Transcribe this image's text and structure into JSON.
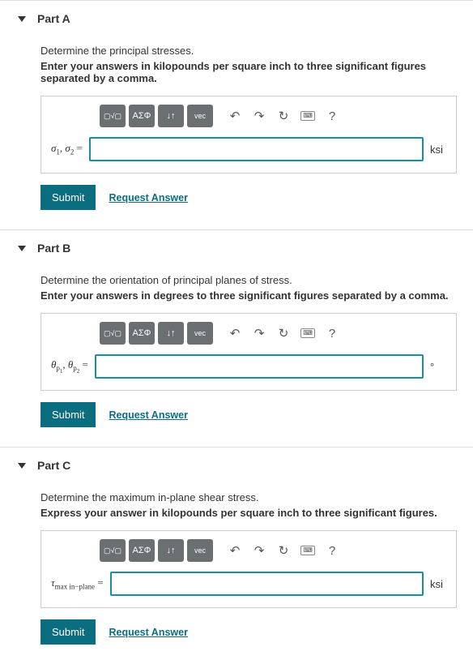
{
  "parts": [
    {
      "title": "Part A",
      "prompt": "Determine the principal stresses.",
      "instruction": "Enter your answers in kilopounds per square inch to three significant figures separated by a comma.",
      "var_html": "<span class='it'>σ</span><sub>1</sub>, <span class='it'>σ</span><sub>2</sub> =",
      "unit": "ksi",
      "value": "",
      "submit": "Submit",
      "request": "Request Answer"
    },
    {
      "title": "Part B",
      "prompt": "Determine the orientation of principal planes of stress.",
      "instruction": "Enter your answers in degrees to three significant figures separated by a comma.",
      "var_html": "<span class='it'>θ</span><sub>p<sub>1</sub></sub>, <span class='it'>θ</span><sub>p<sub>2</sub></sub> =",
      "unit": "°",
      "value": "",
      "submit": "Submit",
      "request": "Request Answer"
    },
    {
      "title": "Part C",
      "prompt": "Determine the maximum in-plane shear stress.",
      "instruction": "Express your answer in kilopounds per square inch to three significant figures.",
      "var_html": "<span class='it'>τ</span><sub>max in−plane</sub> =",
      "unit": "ksi",
      "value": "",
      "submit": "Submit",
      "request": "Request Answer"
    }
  ],
  "toolbar": {
    "template": "▢√▢",
    "greek": "ΑΣΦ",
    "subsup": "↓↑",
    "vec": "vec",
    "undo": "↶",
    "redo": "↷",
    "reset": "↻",
    "keyboard": "⌨",
    "help": "?"
  }
}
